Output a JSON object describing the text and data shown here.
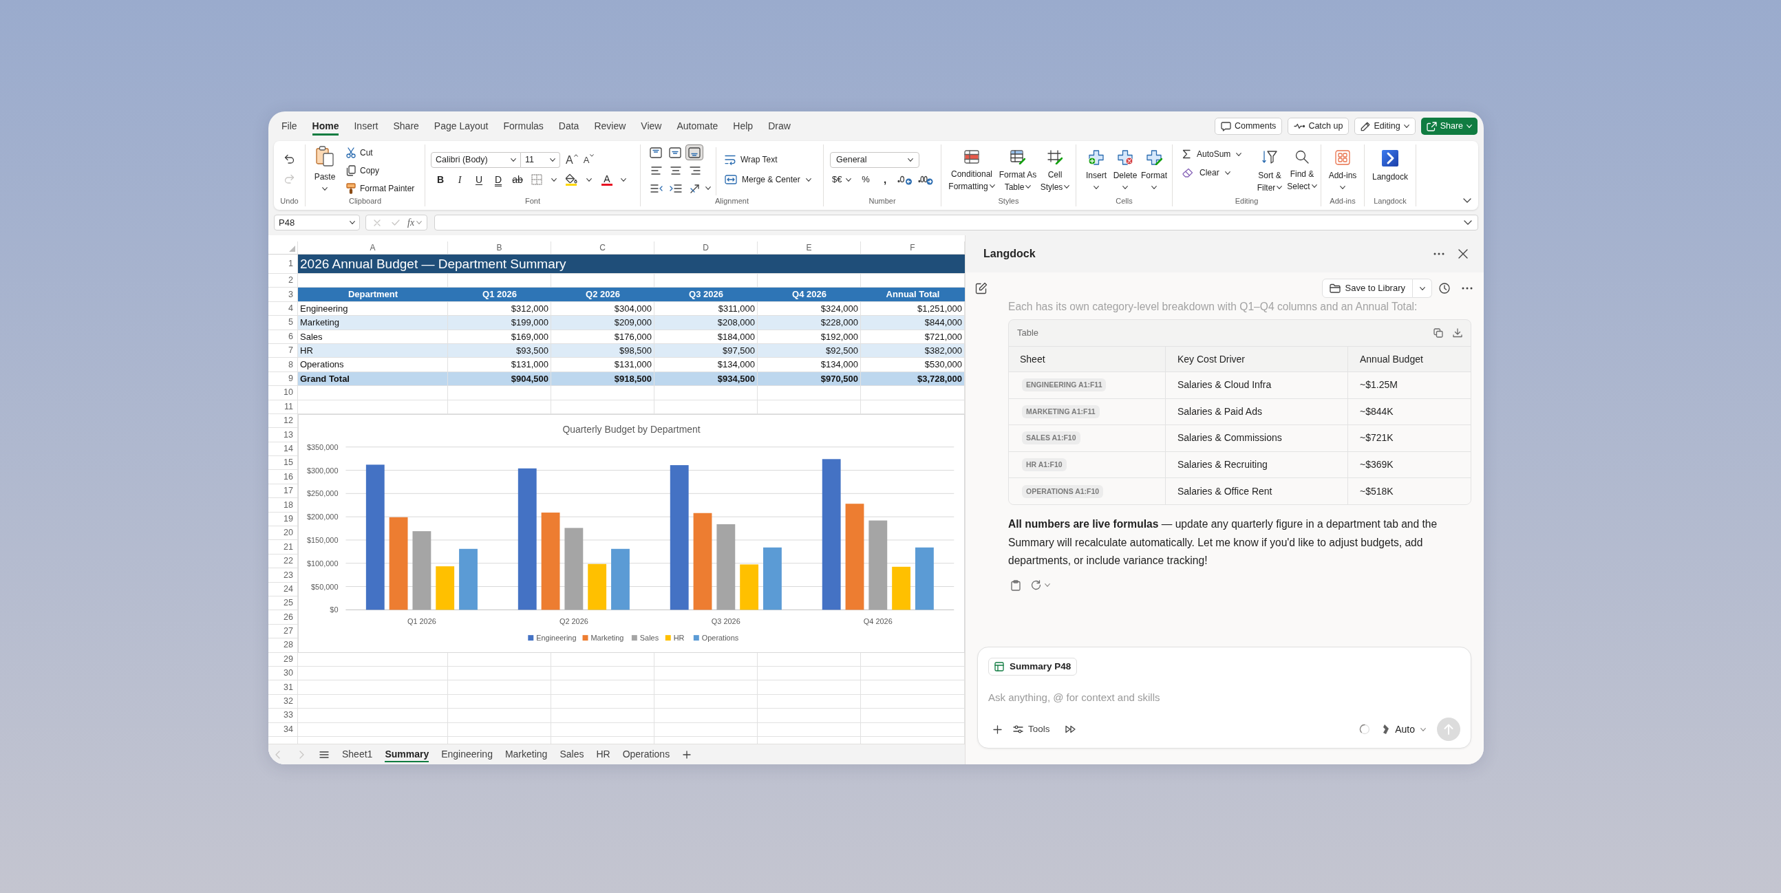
{
  "window": {
    "menu_tabs": [
      {
        "label": "File",
        "selected": false
      },
      {
        "label": "Home",
        "selected": true
      },
      {
        "label": "Insert",
        "selected": false
      },
      {
        "label": "Share",
        "selected": false
      },
      {
        "label": "Page Layout",
        "selected": false
      },
      {
        "label": "Formulas",
        "selected": false
      },
      {
        "label": "Data",
        "selected": false
      },
      {
        "label": "Review",
        "selected": false
      },
      {
        "label": "View",
        "selected": false
      },
      {
        "label": "Automate",
        "selected": false
      },
      {
        "label": "Help",
        "selected": false
      },
      {
        "label": "Draw",
        "selected": false
      }
    ],
    "actions": [
      {
        "kind": "comments",
        "label": "Comments"
      },
      {
        "kind": "catch-up",
        "label": "Catch up"
      },
      {
        "kind": "editing",
        "label": "Editing"
      },
      {
        "kind": "share",
        "label": "Share"
      }
    ]
  },
  "ribbon": {
    "groups": [
      {
        "kind": "undo",
        "label": "Undo",
        "buttons": [
          {
            "kind": "undo",
            "disabled": false
          },
          {
            "kind": "redo",
            "disabled": true
          }
        ]
      },
      {
        "kind": "clipboard",
        "label": "Clipboard",
        "paste": "Paste",
        "items": [
          {
            "kind": "cut",
            "label": "Cut"
          },
          {
            "kind": "copy",
            "label": "Copy"
          },
          {
            "kind": "format-painter",
            "label": "Format Painter"
          }
        ]
      },
      {
        "kind": "font",
        "label": "Font",
        "font_name": "Calibri (Body)",
        "font_size": "11",
        "size_buttons": [
          {
            "kind": "grow",
            "glyph": "A"
          },
          {
            "kind": "shrink",
            "glyph": "A"
          }
        ],
        "style_buttons": [
          {
            "kind": "bold",
            "glyph": "B"
          },
          {
            "kind": "italic",
            "glyph": "I"
          },
          {
            "kind": "underline",
            "glyph": "U"
          },
          {
            "kind": "double-underline",
            "glyph": "D"
          },
          {
            "kind": "strikethrough",
            "glyph": "ab"
          }
        ],
        "color_button": {
          "glyph": "A"
        }
      },
      {
        "kind": "alignment",
        "label": "Alignment",
        "vertical": [
          {
            "kind": "top",
            "selected": false
          },
          {
            "kind": "middle",
            "selected": false
          },
          {
            "kind": "bottom",
            "selected": true
          }
        ],
        "wrap_text": "Wrap Text",
        "merge": "Merge & Center"
      },
      {
        "kind": "number",
        "label": "Number",
        "format": "General",
        "buttons": [
          {
            "kind": "currency",
            "glyph": "$€"
          },
          {
            "kind": "percent",
            "glyph": "%"
          },
          {
            "kind": "comma",
            "glyph": ","
          }
        ]
      },
      {
        "kind": "styles",
        "label": "Styles",
        "items": [
          {
            "kind": "conditional",
            "lines": [
              "Conditional",
              "Formatting"
            ]
          },
          {
            "kind": "table",
            "lines": [
              "Format As",
              "Table"
            ]
          },
          {
            "kind": "cell-styles",
            "lines": [
              "Cell",
              "Styles"
            ]
          }
        ]
      },
      {
        "kind": "cells",
        "label": "Cells",
        "items": [
          {
            "kind": "insert",
            "label": "Insert"
          },
          {
            "kind": "delete",
            "label": "Delete"
          },
          {
            "kind": "format",
            "label": "Format"
          }
        ]
      },
      {
        "kind": "editing",
        "label": "Editing",
        "small": [
          {
            "kind": "autosum",
            "label": "AutoSum"
          },
          {
            "kind": "clear",
            "label": "Clear"
          }
        ],
        "items": [
          {
            "kind": "sort",
            "lines": [
              "Sort &",
              "Filter"
            ]
          },
          {
            "kind": "find",
            "lines": [
              "Find &",
              "Select"
            ]
          }
        ]
      },
      {
        "kind": "addins",
        "label": "Add-ins",
        "button": "Add-ins"
      },
      {
        "kind": "langdock",
        "label": "Langdock",
        "button": "Langdock"
      }
    ]
  },
  "formula_bar": {
    "name_box": "P48",
    "buttons": [
      {
        "kind": "cancel",
        "disabled": true
      },
      {
        "kind": "enter",
        "disabled": true
      }
    ],
    "function_glyph": "fx"
  },
  "sheet": {
    "column_letters": [
      "A",
      "B",
      "C",
      "D",
      "E",
      "F"
    ],
    "row_numbers": [
      "1",
      "2",
      "3",
      "4",
      "5",
      "6",
      "7",
      "8",
      "9",
      "10",
      "11",
      "12",
      "13",
      "14",
      "15",
      "16",
      "17",
      "18",
      "19",
      "20",
      "21",
      "22",
      "23",
      "24",
      "25",
      "26",
      "27",
      "28",
      "29",
      "30",
      "31",
      "32",
      "33",
      "34"
    ],
    "title": "2026 Annual Budget — Department Summary",
    "table": {
      "header": [
        "Department",
        "Q1 2026",
        "Q2 2026",
        "Q3 2026",
        "Q4 2026",
        "Annual Total"
      ],
      "rows": [
        {
          "kind": "data",
          "cells": [
            "Engineering",
            "$312,000",
            "$304,000",
            "$311,000",
            "$324,000",
            "$1,251,000"
          ]
        },
        {
          "kind": "data",
          "cells": [
            "Marketing",
            "$199,000",
            "$209,000",
            "$208,000",
            "$228,000",
            "$844,000"
          ]
        },
        {
          "kind": "data",
          "cells": [
            "Sales",
            "$169,000",
            "$176,000",
            "$184,000",
            "$192,000",
            "$721,000"
          ]
        },
        {
          "kind": "data",
          "cells": [
            "HR",
            "$93,500",
            "$98,500",
            "$97,500",
            "$92,500",
            "$382,000"
          ]
        },
        {
          "kind": "data",
          "cells": [
            "Operations",
            "$131,000",
            "$131,000",
            "$134,000",
            "$134,000",
            "$530,000"
          ]
        },
        {
          "kind": "total",
          "cells": [
            "Grand Total",
            "$904,500",
            "$918,500",
            "$934,500",
            "$970,500",
            "$3,728,000"
          ]
        }
      ]
    },
    "chart": {
      "chart_data": {
        "type": "bar",
        "title": "Quarterly Budget by Department",
        "categories": [
          "Q1 2026",
          "Q2 2026",
          "Q3 2026",
          "Q4 2026"
        ],
        "series": [
          {
            "name": "Engineering",
            "color": "#4472c4",
            "values": [
              312000,
              304000,
              311000,
              324000
            ]
          },
          {
            "name": "Marketing",
            "color": "#ed7d31",
            "values": [
              199000,
              209000,
              208000,
              228000
            ]
          },
          {
            "name": "Sales",
            "color": "#a5a5a5",
            "values": [
              169000,
              176000,
              184000,
              192000
            ]
          },
          {
            "name": "HR",
            "color": "#ffc000",
            "values": [
              93500,
              98500,
              97500,
              92500
            ]
          },
          {
            "name": "Operations",
            "color": "#5b9bd5",
            "values": [
              131000,
              131000,
              134000,
              134000
            ]
          }
        ],
        "ylim": [
          0,
          350000
        ],
        "yticks": [
          {
            "value": 0,
            "label": "$0"
          },
          {
            "value": 50000,
            "label": "$50,000"
          },
          {
            "value": 100000,
            "label": "$100,000"
          },
          {
            "value": 150000,
            "label": "$150,000"
          },
          {
            "value": 200000,
            "label": "$200,000"
          },
          {
            "value": 250000,
            "label": "$250,000"
          },
          {
            "value": 300000,
            "label": "$300,000"
          },
          {
            "value": 350000,
            "label": "$350,000"
          }
        ],
        "grid": true,
        "legend": "bottom"
      }
    }
  },
  "sheet_nav": [
    {
      "kind": "previous",
      "disabled": true
    },
    {
      "kind": "next",
      "disabled": true
    }
  ],
  "sheet_tabs": [
    {
      "label": "Sheet1",
      "selected": false
    },
    {
      "label": "Summary",
      "selected": true
    },
    {
      "label": "Engineering",
      "selected": false
    },
    {
      "label": "Marketing",
      "selected": false
    },
    {
      "label": "Sales",
      "selected": false
    },
    {
      "label": "HR",
      "selected": false
    },
    {
      "label": "Operations",
      "selected": false
    }
  ],
  "panel": {
    "title": "Langdock",
    "save_button": "Save to Library",
    "faded_text": "Each has its own category-level breakdown with Q1–Q4 columns and an Annual Total:",
    "table": {
      "caption": "Table",
      "columns": [
        "Sheet",
        "Key Cost Driver",
        "Annual Budget"
      ],
      "rows": [
        [
          "ENGINEERING A1:F11",
          "Salaries & Cloud Infra",
          "~$1.25M"
        ],
        [
          "MARKETING A1:F11",
          "Salaries & Paid Ads",
          "~$844K"
        ],
        [
          "SALES A1:F10",
          "Salaries & Commissions",
          "~$721K"
        ],
        [
          "HR A1:F10",
          "Salaries & Recruiting",
          "~$369K"
        ],
        [
          "OPERATIONS A1:F10",
          "Salaries & Office Rent",
          "~$518K"
        ]
      ]
    },
    "message": "**All numbers are live formulas** — update any quarterly figure in a department tab and the Summary will recalculate automatically. Let me know if you'd like to adjust budgets, add departments, or include variance tracking!",
    "composer": {
      "context_chip": "Summary P48",
      "placeholder": "Ask anything, @ for context and skills",
      "tools": "Tools",
      "model": "Auto",
      "send_disabled": true
    }
  }
}
